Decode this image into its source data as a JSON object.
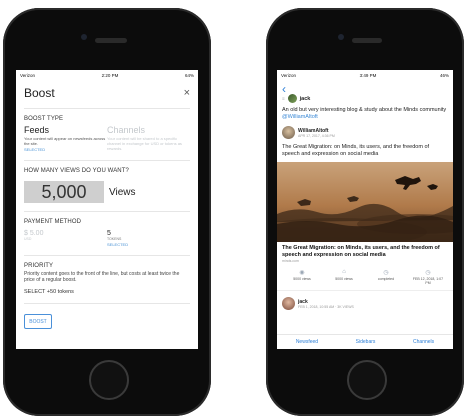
{
  "phone_left": {
    "status": {
      "carrier": "Verizon",
      "time": "2:20 PM",
      "battery": "64%"
    },
    "boost": {
      "title": "Boost",
      "close_glyph": "×",
      "boost_type_heading": "BOOST TYPE",
      "feeds": {
        "title": "Feeds",
        "desc": "Your content will appear on newsfeeds across the site.",
        "selected": "SELECTED"
      },
      "channels": {
        "title": "Channels",
        "desc": "Your content will be shared to a specific channel in exchange for USD or tokens as rewards."
      },
      "views_heading": "HOW MANY VIEWS DO YOU WANT?",
      "views_value": "5,000",
      "views_label": "Views",
      "payment_heading": "PAYMENT METHOD",
      "usd": {
        "value": "$ 5.00",
        "sub": "USD"
      },
      "tokens": {
        "value": "5",
        "sub": "TOKENS",
        "selected": "SELECTED"
      },
      "priority_heading": "PRIORITY",
      "priority_text": "Priority content goes to the front of the line, but costs at least twice the price of a regular boost.",
      "select_tokens": "SELECT +50 tokens",
      "boost_button": "BOOST"
    }
  },
  "phone_right": {
    "status": {
      "carrier": "Verizon",
      "time": "3:49 PM",
      "battery": "46%"
    },
    "back_glyph": "‹",
    "post": {
      "author": "jack",
      "text_before": "An old but very interesting blog & study about the Minds community ",
      "mention": "@WilliamAltoft",
      "quoted_author": "WilliamAltoft",
      "quoted_date": "APR 17, 2017, 4:36 PM",
      "quoted_text": "The Great Migration: on Minds, its users, and the freedom of speech and expression on social media",
      "card_title": "The Great Migration: on Minds, its users, and the freedom of speech and expression on social media",
      "card_domain": "minds.com",
      "stats": [
        {
          "icon": "eye-icon",
          "glyph": "◉",
          "label": "5000 views"
        },
        {
          "icon": "bank-icon",
          "glyph": "⌂",
          "label": "5000 views"
        },
        {
          "icon": "clock-icon",
          "glyph": "◷",
          "label": "completed"
        },
        {
          "icon": "clock-icon",
          "glyph": "◷",
          "label": "FEB 12, 2018, 1:07 PM"
        }
      ],
      "comment_author": "jack",
      "comment_meta": "FEB 1, 2018, 10:55 AM · 3K VIEWS"
    },
    "tabs": [
      "Newsfeed",
      "Sidebars",
      "Channels"
    ]
  },
  "colors": {
    "accent_blue": "#4a90d9",
    "phone_body": "#0c0c0c",
    "views_box": "#cfcfcf"
  }
}
